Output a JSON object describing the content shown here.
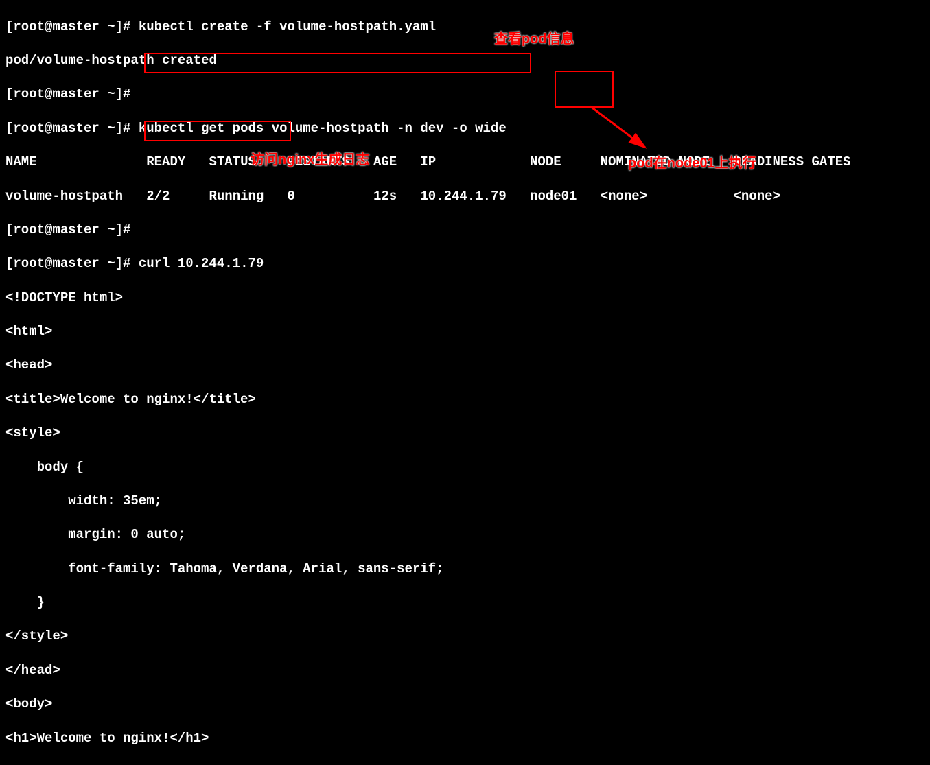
{
  "prompt": "[root@master ~]# ",
  "lines": {
    "l1": "kubectl create -f volume-hostpath.yaml",
    "l2": "pod/volume-hostpath created",
    "l3": "",
    "l4": "kubectl get pods volume-hostpath -n dev -o wide",
    "l5_headers": "NAME              READY   STATUS    RESTARTS   AGE   IP            NODE     NOMINATED NODE   READINESS GATES",
    "l5_name": "NAME",
    "l5_ready": "READY",
    "l5_status": "STATUS",
    "l5_restarts": "RESTARTS",
    "l5_age": "AGE",
    "l5_ip": "IP",
    "l5_node": "NODE",
    "l5_nominated": "NOMINATED NODE",
    "l5_readiness": "READINESS GATES",
    "l6_name": "volume-hostpath",
    "l6_ready": "2/2",
    "l6_status": "Running",
    "l6_restarts": "0",
    "l6_age": "12s",
    "l6_ip": "10.244.1.79",
    "l6_node": "node01",
    "l6_nominated": "<none>",
    "l6_readiness": "<none>",
    "l7": "",
    "l8": "curl 10.244.1.79",
    "l9": "<!DOCTYPE html>",
    "l10": "<html>",
    "l11": "<head>",
    "l12": "<title>Welcome to nginx!</title>",
    "l13": "<style>",
    "l14": "    body {",
    "l15": "        width: 35em;",
    "l16": "        margin: 0 auto;",
    "l17": "        font-family: Tahoma, Verdana, Arial, sans-serif;",
    "l18": "    }",
    "l19": "</style>",
    "l20": "</head>",
    "l21": "<body>",
    "l22": "<h1>Welcome to nginx!</h1>"
  },
  "annotations": {
    "a1": "查看pod信息",
    "a2": "访问nginx生成日志",
    "a3": "pod在node01上执行"
  }
}
